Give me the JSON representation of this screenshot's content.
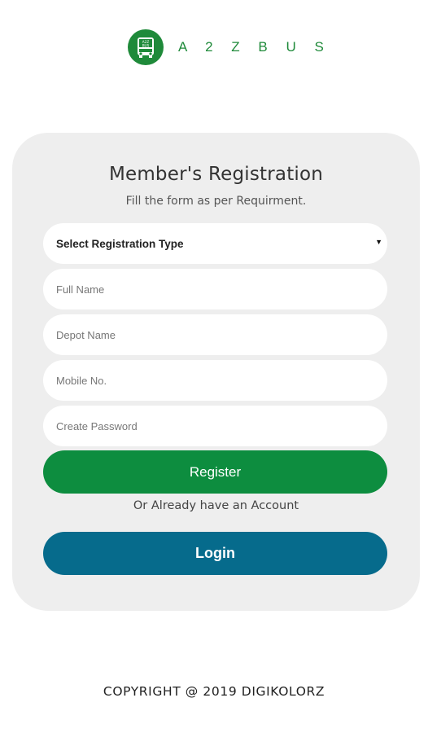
{
  "brand": {
    "logo_text": "A2Z BUS",
    "name": "A 2 Z B U S"
  },
  "form": {
    "title": "Member's Registration",
    "subtitle": "Fill the form as per Requirment.",
    "registration_type": {
      "selected": "Select Registration Type"
    },
    "fields": {
      "full_name_placeholder": "Full Name",
      "depot_name_placeholder": "Depot Name",
      "mobile_placeholder": "Mobile No.",
      "password_placeholder": "Create Password"
    },
    "register_label": "Register",
    "or_text": "Or Already have an Account",
    "login_label": "Login"
  },
  "footer": {
    "copyright": "COPYRIGHT @ 2019 DIGIKOLORZ"
  },
  "colors": {
    "brand_green": "#1f8a3a",
    "register_green": "#0d8d3f",
    "login_blue": "#066b8c",
    "card_bg": "#eeeeee"
  }
}
